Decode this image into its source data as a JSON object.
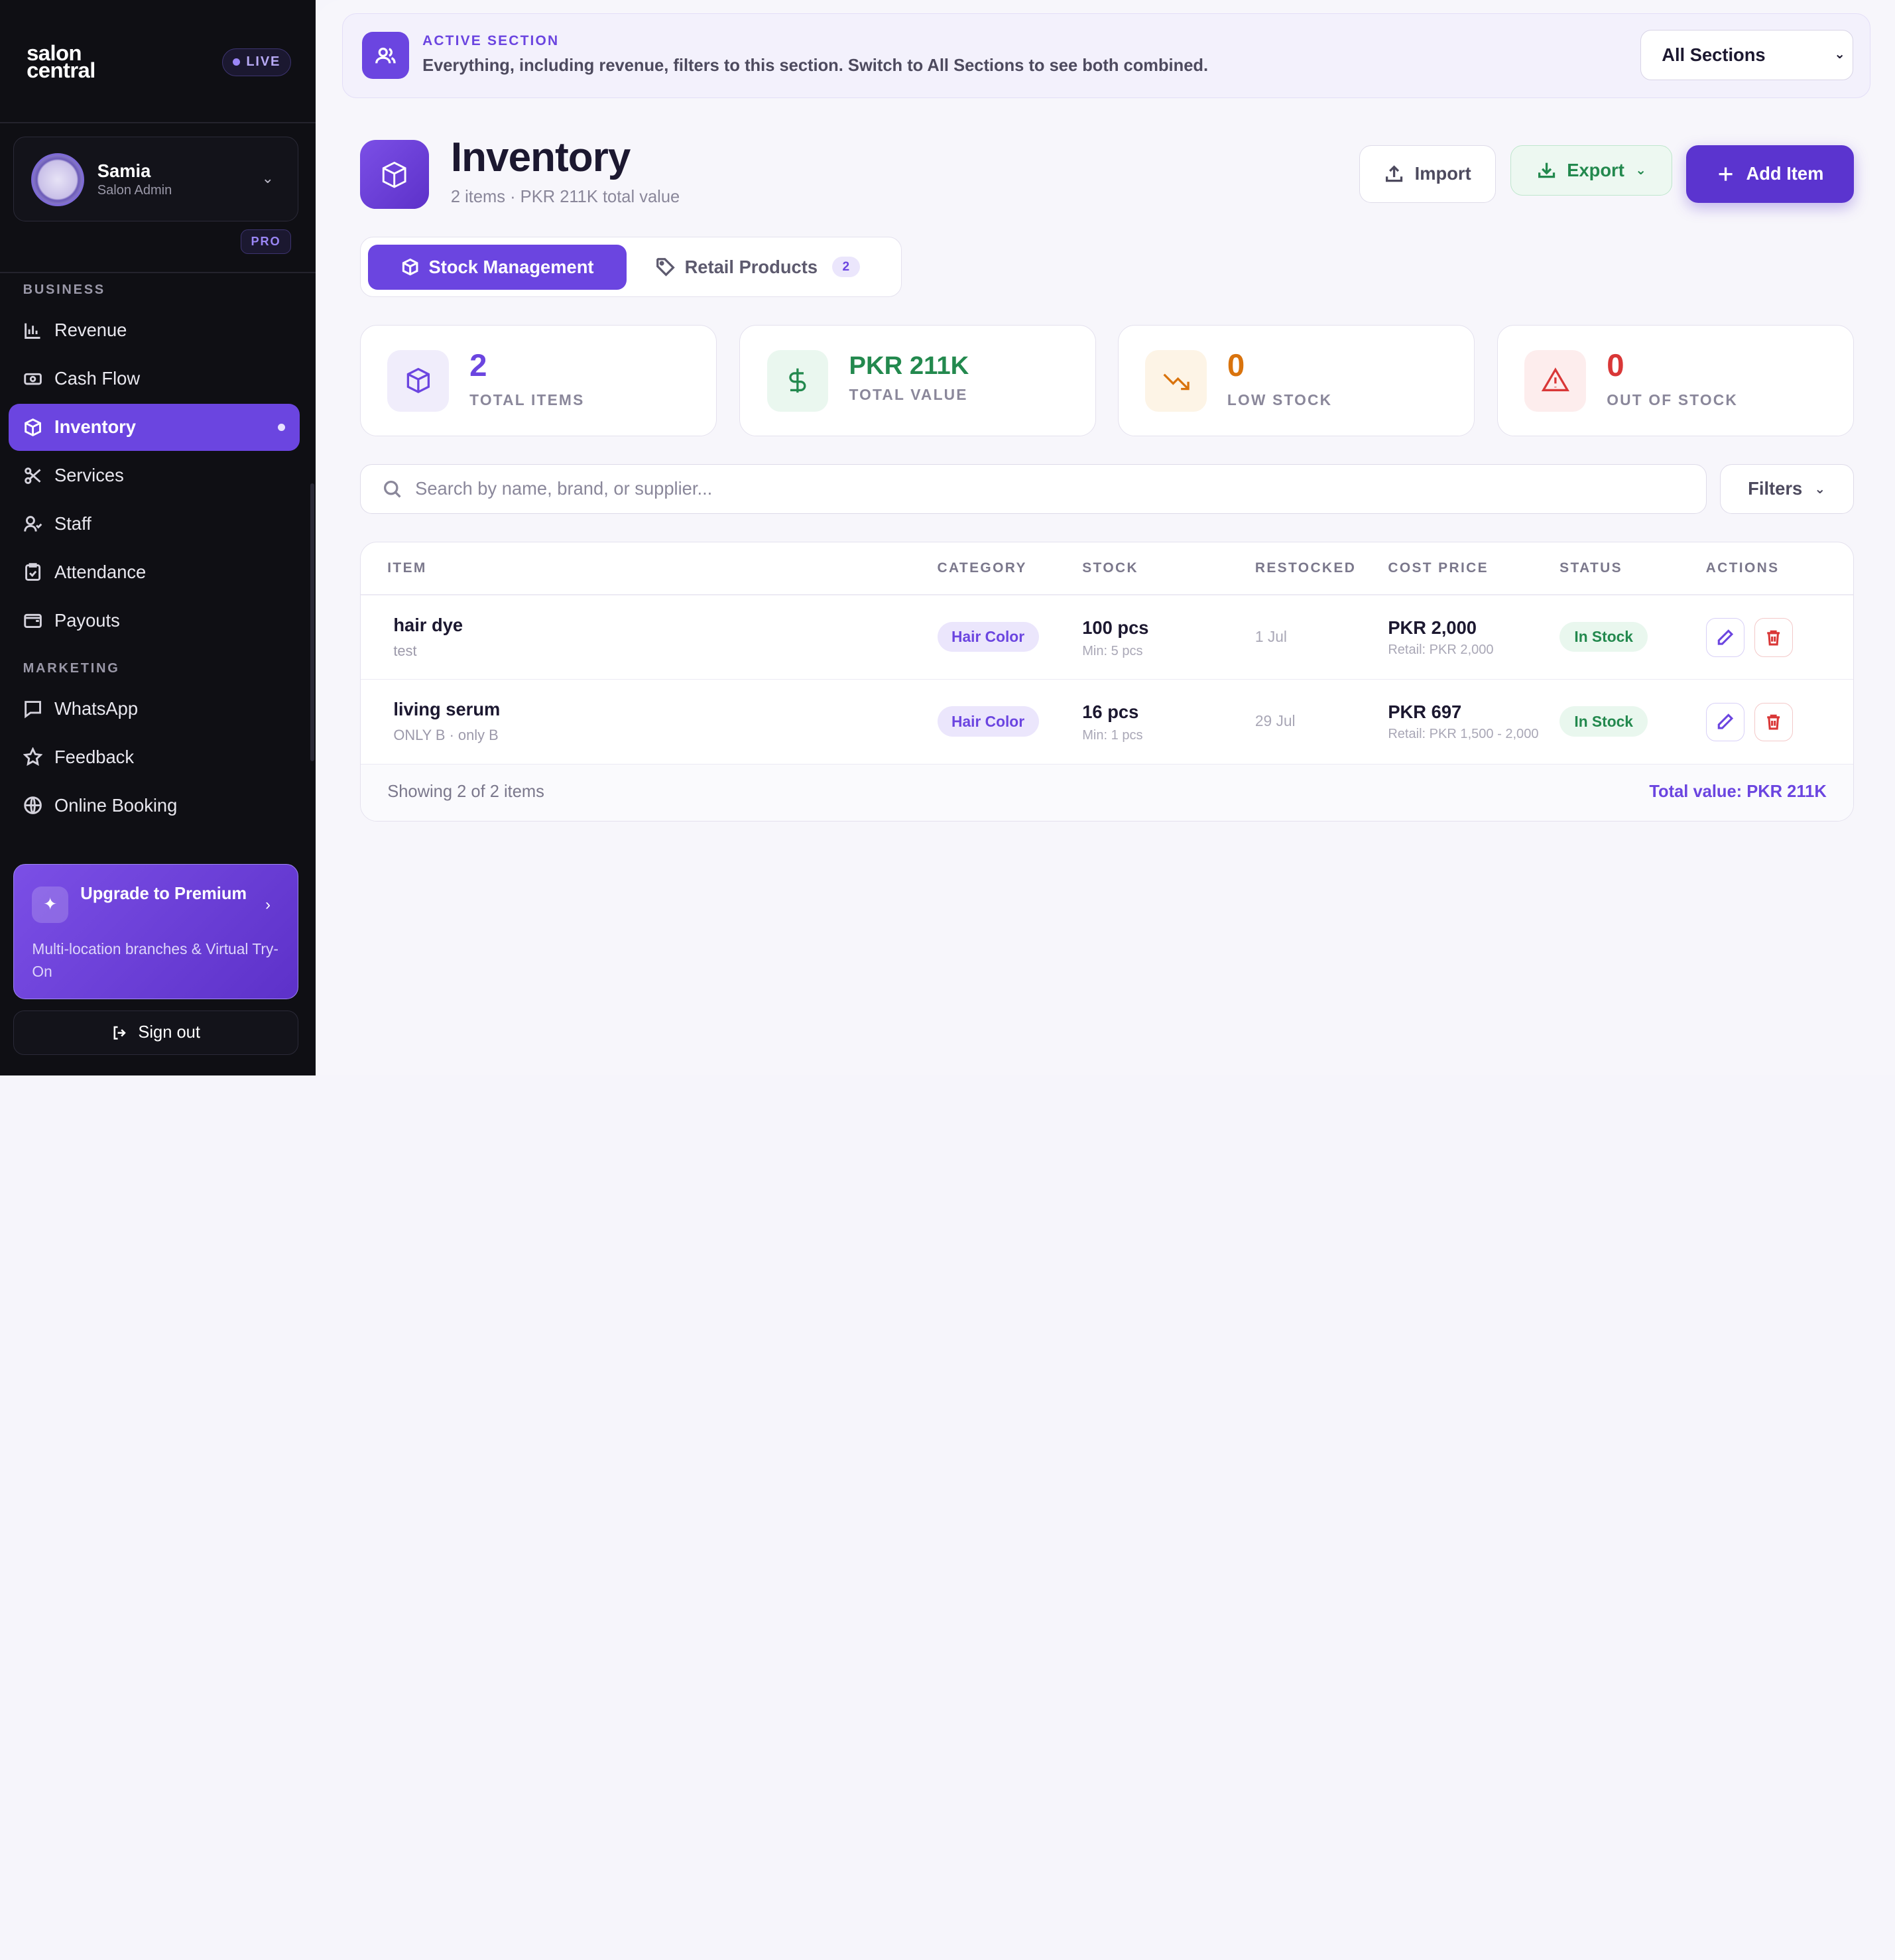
{
  "sidebar": {
    "logo_line1": "salon",
    "logo_line2": "central",
    "live_label": "LIVE",
    "user_name": "Samia",
    "user_role": "Salon Admin",
    "plan_badge": "PRO",
    "section_business": "BUSINESS",
    "section_marketing": "MARKETING",
    "items": [
      {
        "label": "Revenue",
        "icon": "bar-chart-icon"
      },
      {
        "label": "Cash Flow",
        "icon": "cash-icon"
      },
      {
        "label": "Inventory",
        "icon": "package-icon",
        "active": true
      },
      {
        "label": "Services",
        "icon": "scissors-icon"
      },
      {
        "label": "Staff",
        "icon": "staff-icon"
      },
      {
        "label": "Attendance",
        "icon": "clipboard-icon"
      },
      {
        "label": "Payouts",
        "icon": "wallet-icon"
      },
      {
        "label": "WhatsApp",
        "icon": "message-icon"
      },
      {
        "label": "Feedback",
        "icon": "star-icon"
      },
      {
        "label": "Online Booking",
        "icon": "globe-icon"
      }
    ],
    "upgrade_title": "Upgrade to Premium",
    "upgrade_desc": "Multi-location branches & Virtual Try-On",
    "signout_label": "Sign out"
  },
  "banner": {
    "title": "ACTIVE SECTION",
    "description": "Everything, including revenue, filters to this section. Switch to All Sections to see both combined.",
    "select_value": "All Sections"
  },
  "page": {
    "title": "Inventory",
    "subtitle": "2 items · PKR 211K total value",
    "import_label": "Import",
    "export_label": "Export",
    "add_label": "Add Item"
  },
  "tabs": {
    "stock_label": "Stock Management",
    "retail_label": "Retail Products",
    "retail_count": "2"
  },
  "stats": [
    {
      "value": "2",
      "label": "TOTAL ITEMS",
      "color": "#6b45e0"
    },
    {
      "value": "PKR 211K",
      "label": "TOTAL VALUE",
      "color": "#23894e"
    },
    {
      "value": "0",
      "label": "LOW STOCK",
      "color": "#d9730d"
    },
    {
      "value": "0",
      "label": "OUT OF STOCK",
      "color": "#d93737"
    }
  ],
  "search": {
    "placeholder": "Search by name, brand, or supplier...",
    "filters_label": "Filters"
  },
  "table": {
    "headers": [
      "ITEM",
      "CATEGORY",
      "STOCK",
      "RESTOCKED",
      "COST PRICE",
      "STATUS",
      "ACTIONS"
    ],
    "rows": [
      {
        "name": "hair dye",
        "sub": "test",
        "category": "Hair Color",
        "stock": "100 pcs",
        "min": "Min: 5 pcs",
        "restocked": "1 Jul",
        "cost": "PKR 2,000",
        "retail": "Retail: PKR 2,000",
        "status": "In Stock"
      },
      {
        "name": "living serum",
        "sub": "ONLY B · only B",
        "category": "Hair Color",
        "stock": "16 pcs",
        "min": "Min: 1 pcs",
        "restocked": "29 Jul",
        "cost": "PKR 697",
        "retail": "Retail: PKR 1,500 - 2,000",
        "status": "In Stock"
      }
    ],
    "footer_showing": "Showing 2 of 2 items",
    "footer_total": "Total value: PKR 211K"
  }
}
